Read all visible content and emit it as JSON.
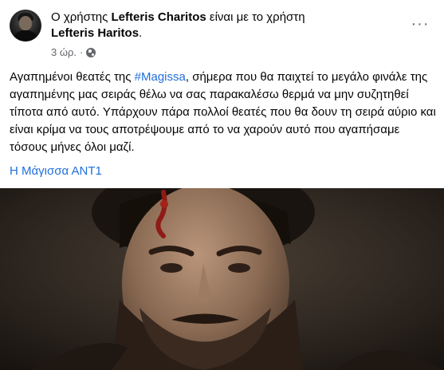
{
  "post": {
    "header": {
      "prefix": "Ο χρήστης ",
      "author": "Lefteris Charitos",
      "middle": " είναι με το χρήστη",
      "tagged": "Lefteris Haritos",
      "suffix": "."
    },
    "timestamp": "3 ώρ.",
    "separator": "·",
    "privacy_icon": "globe-icon",
    "more_icon": "more-horizontal-icon",
    "more_label": "···",
    "body": {
      "before_hashtag": "Αγαπημένοι θεατές της ",
      "hashtag": "#Magissa",
      "after_hashtag": ", σήμερα που θα παιχτεί το μεγάλο φινάλε της αγαπημένης μας σειράς θέλω να σας παρακαλέσω θερμά να μην συζητηθεί τίποτα από αυτό. Υπάρχουν πάρα πολλοί θεατές που θα δουν τη σειρά αύριο και είναι κρίμα να τους αποτρέψουμε από το να χαρούν αυτό που αγαπήσαμε τόσους μήνες όλοι μαζί."
    },
    "page_link": "Η Μάγισσα ΑΝΤ1",
    "colors": {
      "link": "#216fdb",
      "text": "#050505",
      "meta": "#65676b"
    }
  }
}
